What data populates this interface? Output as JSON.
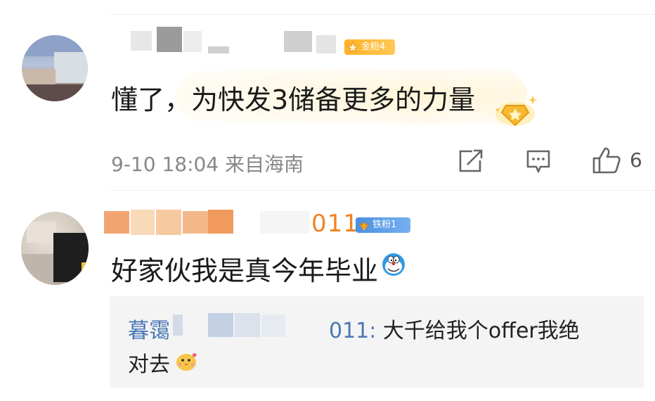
{
  "comments": [
    {
      "badge": "金粉4",
      "text": "懂了，为快发3储备更多的力量",
      "meta": "9-10 18:04 来自海南",
      "likes": "6"
    },
    {
      "nick_suffix": "011",
      "badge": "铁粉1",
      "text": "好家伙我是真今年毕业",
      "reply": {
        "author_prefix": "暮霭",
        "author_suffix": "011:",
        "text_line1": "大千给我个offer我绝",
        "text_line2": "对去"
      }
    }
  ],
  "icons": {
    "share": "share-icon",
    "comment": "comment-icon",
    "like": "thumbs-up-icon",
    "doraemon": "doraemon-emoji-icon",
    "chick": "chick-emoji-icon",
    "gold_badge": "gold-fan-badge-icon",
    "iron_badge": "iron-fan-badge-icon",
    "crown_star": "crown-star-decoration-icon"
  },
  "colors": {
    "username_orange": "#f08322",
    "reply_author_blue": "#4a78b4",
    "gold_badge": "#ffb128",
    "iron_badge": "#4a90e2",
    "meta_gray": "#888888"
  }
}
